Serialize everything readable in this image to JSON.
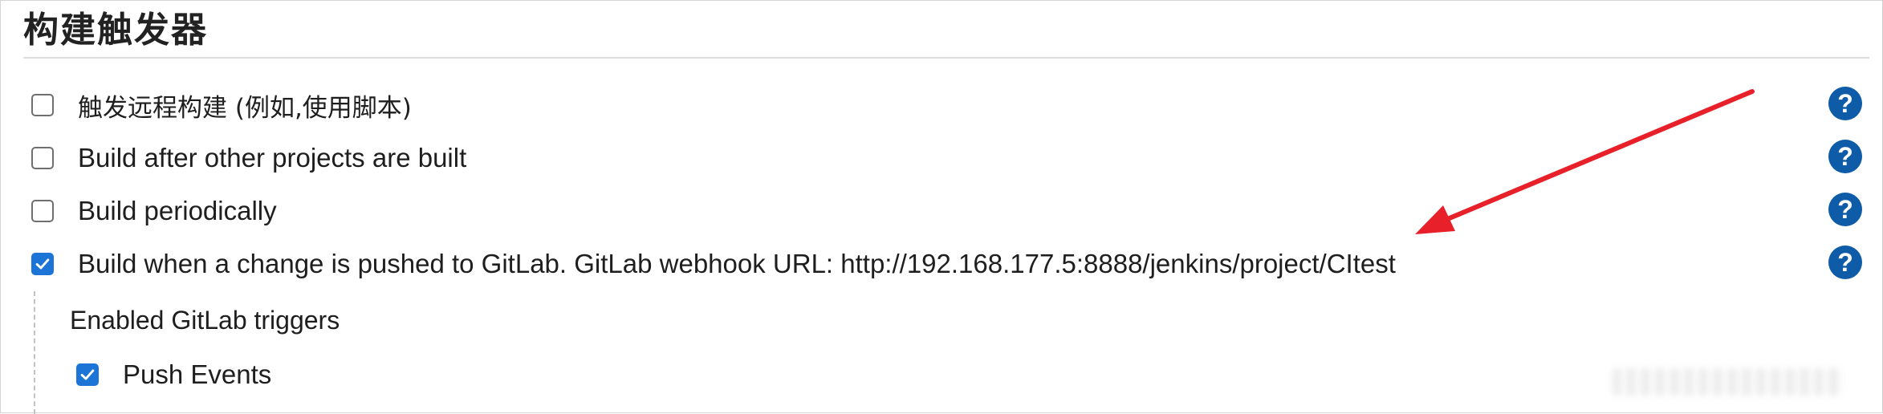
{
  "section": {
    "title": "构建触发器"
  },
  "triggers": [
    {
      "label": "触发远程构建 (例如,使用脚本)",
      "checked": false,
      "help": "?"
    },
    {
      "label": "Build after other projects are built",
      "checked": false,
      "help": "?"
    },
    {
      "label": "Build periodically",
      "checked": false,
      "help": "?"
    },
    {
      "label": "Build when a change is pushed to GitLab. GitLab webhook URL: http://192.168.177.5:8888/jenkins/project/CItest",
      "checked": true,
      "help": "?"
    }
  ],
  "gitlab": {
    "subheading": "Enabled GitLab triggers",
    "push_events": {
      "label": "Push Events",
      "checked": true
    }
  },
  "colors": {
    "checkbox_checked": "#1c74d6",
    "help_icon": "#0e5ba8",
    "annotation_arrow": "#e8202a"
  }
}
